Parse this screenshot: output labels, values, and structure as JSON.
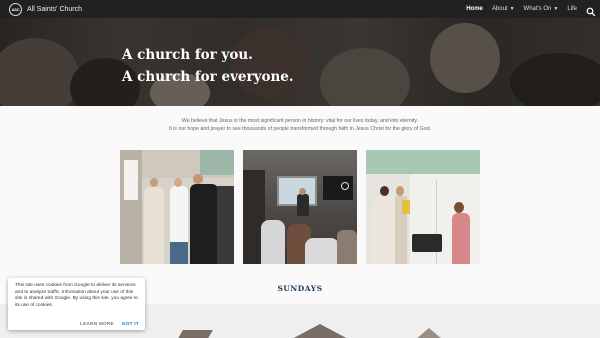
{
  "header": {
    "logo_text": "ASC",
    "site_title": "All Saints' Church",
    "nav": [
      {
        "label": "Home",
        "active": true
      },
      {
        "label": "About",
        "dropdown": true
      },
      {
        "label": "What's On",
        "dropdown": true
      },
      {
        "label": "Life"
      }
    ],
    "search_icon": "search-icon"
  },
  "hero": {
    "line1": "A church for you.",
    "line2": "A church for everyone."
  },
  "intro": {
    "line1": "We believe that Jesus is the most significant person in history:  vital for our lives today, and into eternity.",
    "line2": "It is our hope and prayer to see thousands of people transformed through faith in Jesus Christ for the glory of God."
  },
  "photos": [
    "people-chatting-photo",
    "congregation-service-photo",
    "kitchen-conversation-photo"
  ],
  "section": {
    "sundays_heading": "SUNDAYS"
  },
  "cookie": {
    "text": "This site uses cookies from Google to deliver its services and to analyze traffic. Information about your use of this site is shared with Google. By using this site, you agree to its use of cookies.",
    "learn_more": "LEARN MORE",
    "got_it": "GOT IT"
  },
  "colors": {
    "topbar": "#212121",
    "heading_navy": "#1f3a5a",
    "link_blue": "#1f6ebf"
  }
}
